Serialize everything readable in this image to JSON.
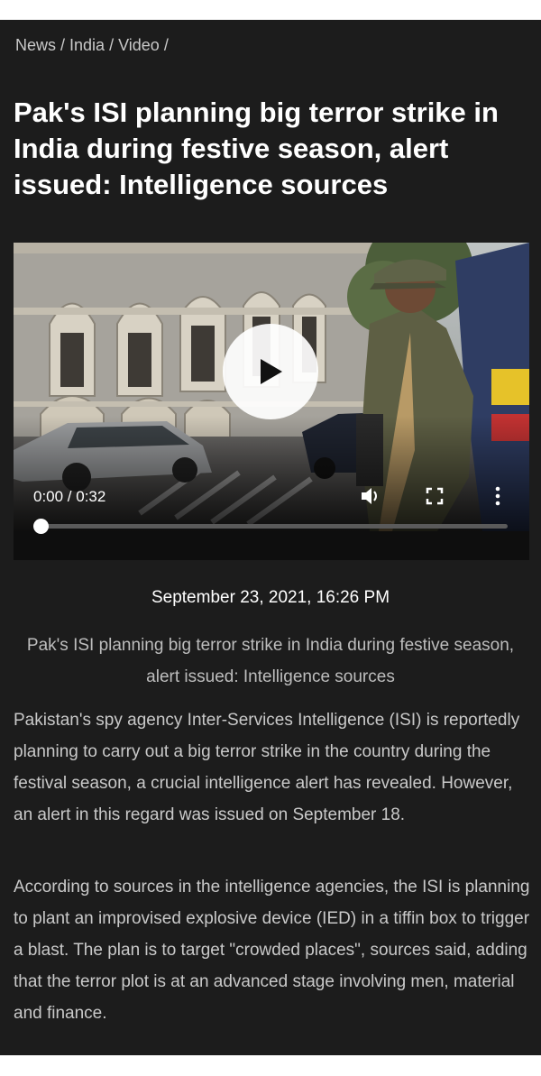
{
  "breadcrumb": {
    "items": [
      "News",
      "India",
      "Video"
    ],
    "separator": "/"
  },
  "article": {
    "headline": "Pak's ISI planning big terror strike in India during festive season, alert issued: Intelligence sources",
    "dateline": "September 23, 2021, 16:26 PM",
    "caption": "Pak's ISI planning big terror strike in India during festive season, alert issued: Intelligence sources",
    "paragraphs": [
      "Pakistan's spy agency Inter-Services Intelligence (ISI) is reportedly planning to carry out a big terror strike in the country during the festival season, a crucial intelligence alert has revealed. However, an alert in this regard was issued on September 18.",
      "According to sources in the intelligence agencies, the ISI is planning to plant an improvised explosive device (IED) in a tiffin box to trigger a blast. The plan is to target \"crowded places\", sources said, adding that the terror plot is at an advanced stage involving men, material and finance."
    ]
  },
  "video_player": {
    "time_display": "0:00 / 0:32",
    "progress_fraction": 0.0,
    "icons": [
      "play-icon",
      "volume-icon",
      "fullscreen-icon",
      "more-options-icon"
    ]
  },
  "colors": {
    "page_background": "#1c1c1c",
    "headline_text": "#ffffff",
    "body_text": "#c9c9c9"
  }
}
